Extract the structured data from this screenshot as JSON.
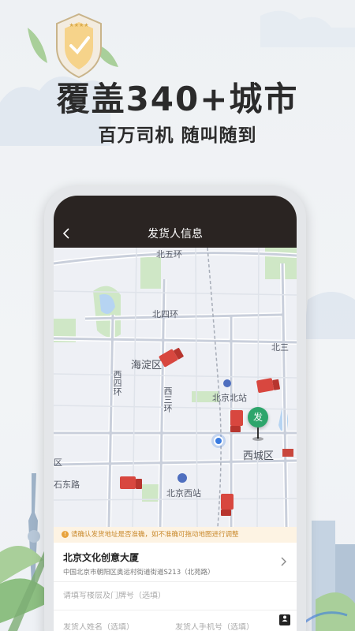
{
  "headline": "覆盖340+城市",
  "subline": "百万司机 随叫随到",
  "phone": {
    "nav": {
      "back_icon": "chevron-left-icon",
      "title": "发货人信息"
    },
    "map": {
      "labels": {
        "ring5": "北五环",
        "ring4": "北四环",
        "ring3_north": "北三",
        "haidian": "海淀区",
        "xisihuan": "西四环",
        "xisanhuan": "西三环",
        "beijing_north": "北京北站",
        "xicheng": "西城区",
        "shidong": "石东路",
        "beijing_west": "北京西站",
        "edge_qu": "区"
      },
      "marker_text": "发",
      "colors": {
        "truck": "#d8473f",
        "marker": "#2da56b",
        "location": "#3a7be0"
      }
    },
    "notice": "请确认发货地址是否准确，如不准确可拖动地图进行调整",
    "address": {
      "name": "北京文化创意大厦",
      "detail": "中国北京市朝阳区奥运村街道街道S213（北苑路）"
    },
    "floor_placeholder": "请填写楼层及门牌号（选填）",
    "name_placeholder": "发货人姓名（选填）",
    "phone_placeholder": "发货人手机号（选填）"
  }
}
